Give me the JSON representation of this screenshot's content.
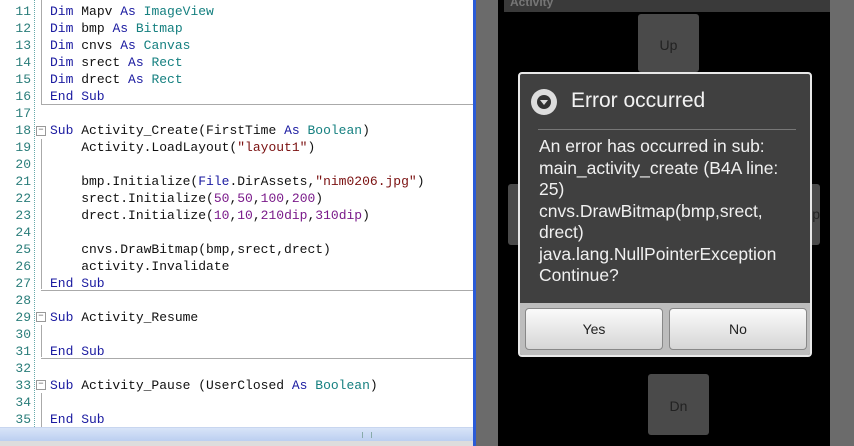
{
  "editor": {
    "lines": [
      {
        "n": "11",
        "tokens": [
          [
            "kw",
            "Dim "
          ],
          [
            "pl",
            "Mapv "
          ],
          [
            "kw",
            "As "
          ],
          [
            "ty",
            "ImageView"
          ]
        ]
      },
      {
        "n": "12",
        "tokens": [
          [
            "kw",
            "Dim "
          ],
          [
            "pl",
            "bmp "
          ],
          [
            "kw",
            "As "
          ],
          [
            "ty",
            "Bitmap"
          ]
        ]
      },
      {
        "n": "13",
        "tokens": [
          [
            "kw",
            "Dim "
          ],
          [
            "pl",
            "cnvs "
          ],
          [
            "kw",
            "As "
          ],
          [
            "ty",
            "Canvas"
          ]
        ]
      },
      {
        "n": "14",
        "tokens": [
          [
            "kw",
            "Dim "
          ],
          [
            "pl",
            "srect "
          ],
          [
            "kw",
            "As "
          ],
          [
            "ty",
            "Rect"
          ]
        ]
      },
      {
        "n": "15",
        "tokens": [
          [
            "kw",
            "Dim "
          ],
          [
            "pl",
            "drect "
          ],
          [
            "kw",
            "As "
          ],
          [
            "ty",
            "Rect"
          ]
        ]
      },
      {
        "n": "16",
        "tokens": [
          [
            "kw",
            "End Sub"
          ]
        ]
      },
      {
        "n": "17",
        "tokens": []
      },
      {
        "n": "18",
        "tokens": [
          [
            "kw",
            "Sub "
          ],
          [
            "pl",
            "Activity_Create(FirstTime "
          ],
          [
            "kw",
            "As "
          ],
          [
            "ty",
            "Boolean"
          ],
          [
            "pl",
            ")"
          ]
        ]
      },
      {
        "n": "19",
        "tokens": [
          [
            "pl",
            "    Activity.LoadLayout("
          ],
          [
            "st",
            "\"layout1\""
          ],
          [
            "pl",
            ")"
          ]
        ]
      },
      {
        "n": "20",
        "tokens": []
      },
      {
        "n": "21",
        "tokens": [
          [
            "pl",
            "    bmp.Initialize("
          ],
          [
            "kw",
            "File"
          ],
          [
            "pl",
            ".DirAssets,"
          ],
          [
            "st",
            "\"nim0206.jpg\""
          ],
          [
            "pl",
            ")"
          ]
        ]
      },
      {
        "n": "22",
        "tokens": [
          [
            "pl",
            "    srect.Initialize("
          ],
          [
            "nu",
            "50"
          ],
          [
            "pl",
            ","
          ],
          [
            "nu",
            "50"
          ],
          [
            "pl",
            ","
          ],
          [
            "nu",
            "100"
          ],
          [
            "pl",
            ","
          ],
          [
            "nu",
            "200"
          ],
          [
            "pl",
            ")"
          ]
        ]
      },
      {
        "n": "23",
        "tokens": [
          [
            "pl",
            "    drect.Initialize("
          ],
          [
            "nu",
            "10"
          ],
          [
            "pl",
            ","
          ],
          [
            "nu",
            "10"
          ],
          [
            "pl",
            ","
          ],
          [
            "nu",
            "210dip"
          ],
          [
            "pl",
            ","
          ],
          [
            "nu",
            "310dip"
          ],
          [
            "pl",
            ")"
          ]
        ]
      },
      {
        "n": "24",
        "tokens": []
      },
      {
        "n": "25",
        "tokens": [
          [
            "pl",
            "    cnvs.DrawBitmap(bmp,srect,drect)"
          ]
        ]
      },
      {
        "n": "26",
        "tokens": [
          [
            "pl",
            "    activity.Invalidate"
          ]
        ]
      },
      {
        "n": "27",
        "tokens": [
          [
            "kw",
            "End Sub"
          ]
        ]
      },
      {
        "n": "28",
        "tokens": []
      },
      {
        "n": "29",
        "tokens": [
          [
            "kw",
            "Sub "
          ],
          [
            "pl",
            "Activity_Resume"
          ]
        ]
      },
      {
        "n": "30",
        "tokens": []
      },
      {
        "n": "31",
        "tokens": [
          [
            "kw",
            "End Sub"
          ]
        ]
      },
      {
        "n": "32",
        "tokens": []
      },
      {
        "n": "33",
        "tokens": [
          [
            "kw",
            "Sub "
          ],
          [
            "pl",
            "Activity_Pause (UserClosed "
          ],
          [
            "kw",
            "As "
          ],
          [
            "ty",
            "Boolean"
          ],
          [
            "pl",
            ")"
          ]
        ]
      },
      {
        "n": "34",
        "tokens": []
      },
      {
        "n": "35",
        "tokens": [
          [
            "kw",
            "End Sub"
          ]
        ]
      }
    ]
  },
  "emulator": {
    "activity_title": "Activity",
    "buttons": {
      "up": "Up",
      "down": "Dn",
      "left": "",
      "right": "p"
    }
  },
  "dialog": {
    "title": "Error occurred",
    "icon": "alert-down-arrow-icon",
    "body_lines": [
      "An error has occurred in sub:",
      "main_activity_create (B4A line:",
      "25)",
      "cnvs.DrawBitmap(bmp,srect,",
      "drect)",
      "java.lang.NullPointerException",
      "Continue?"
    ],
    "yes_label": "Yes",
    "no_label": "No"
  }
}
